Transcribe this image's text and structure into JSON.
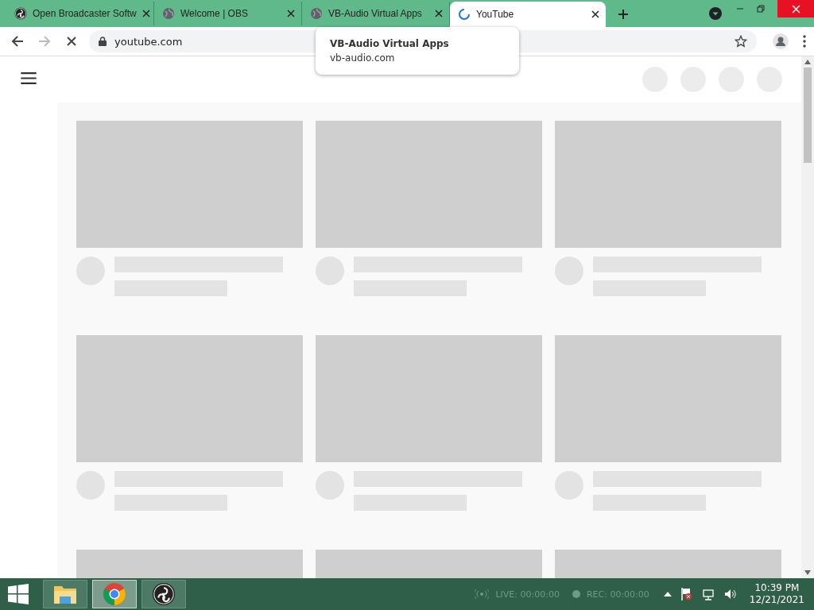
{
  "tabs": [
    {
      "title": "Open Broadcaster Softw",
      "kind": "obs",
      "selected": false
    },
    {
      "title": "Welcome | OBS",
      "kind": "globe",
      "selected": false
    },
    {
      "title": "VB-Audio Virtual Apps",
      "kind": "globe",
      "selected": false
    },
    {
      "title": "YouTube",
      "kind": "spinner",
      "selected": true
    }
  ],
  "address": "youtube.com",
  "tooltip": {
    "title": "VB-Audio Virtual Apps",
    "url": "vb-audio.com"
  },
  "taskbar": {
    "apps": [
      {
        "kind": "folder",
        "selected": false
      },
      {
        "kind": "chrome",
        "selected": true
      },
      {
        "kind": "obs",
        "selected": false
      }
    ],
    "live": "LIVE: 00:00:00",
    "rec": "REC: 00:00:00",
    "time": "10:39 PM",
    "date": "12/21/2021"
  }
}
